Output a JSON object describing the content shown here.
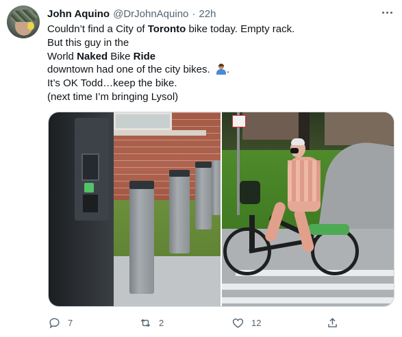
{
  "tweet": {
    "author": {
      "name": "John Aquino",
      "handle": "@DrJohnAquino",
      "separator": "·",
      "time": "22h"
    },
    "text_lines": [
      [
        {
          "t": "Couldn’t find a City of ",
          "b": false
        },
        {
          "t": "Toronto",
          "b": true
        },
        {
          "t": " bike today. Empty rack.",
          "b": false
        }
      ],
      [
        {
          "t": "But this guy in the",
          "b": false
        }
      ],
      [
        {
          "t": "World ",
          "b": false
        },
        {
          "t": "Naked",
          "b": true
        },
        {
          "t": " Bike ",
          "b": false
        },
        {
          "t": "Ride",
          "b": true
        }
      ],
      [
        {
          "t": "downtown had one of the city bikes. ",
          "b": false
        },
        {
          "t": ".",
          "b": false,
          "emoji_before": true
        }
      ],
      [
        {
          "t": "It’s OK Todd…keep the bike.",
          "b": false
        }
      ],
      [
        {
          "t": "(next time I’m bringing Lysol)",
          "b": false
        }
      ]
    ],
    "emoji": "person-gesturing-emoji",
    "media": [
      {
        "name": "empty-bike-rack-photo"
      },
      {
        "name": "naked-cyclist-on-city-bike-photo"
      }
    ],
    "actions": {
      "replies": "7",
      "retweets": "2",
      "likes": "12",
      "share": ""
    },
    "icons": {
      "reply": "speech-bubble-icon",
      "retweet": "retweet-arrows-icon",
      "like": "heart-icon",
      "share": "share-upload-icon",
      "more": "more-dots-icon"
    },
    "colors": {
      "text": "#0f1419",
      "secondary": "#536471",
      "border": "#cfd9de"
    }
  }
}
